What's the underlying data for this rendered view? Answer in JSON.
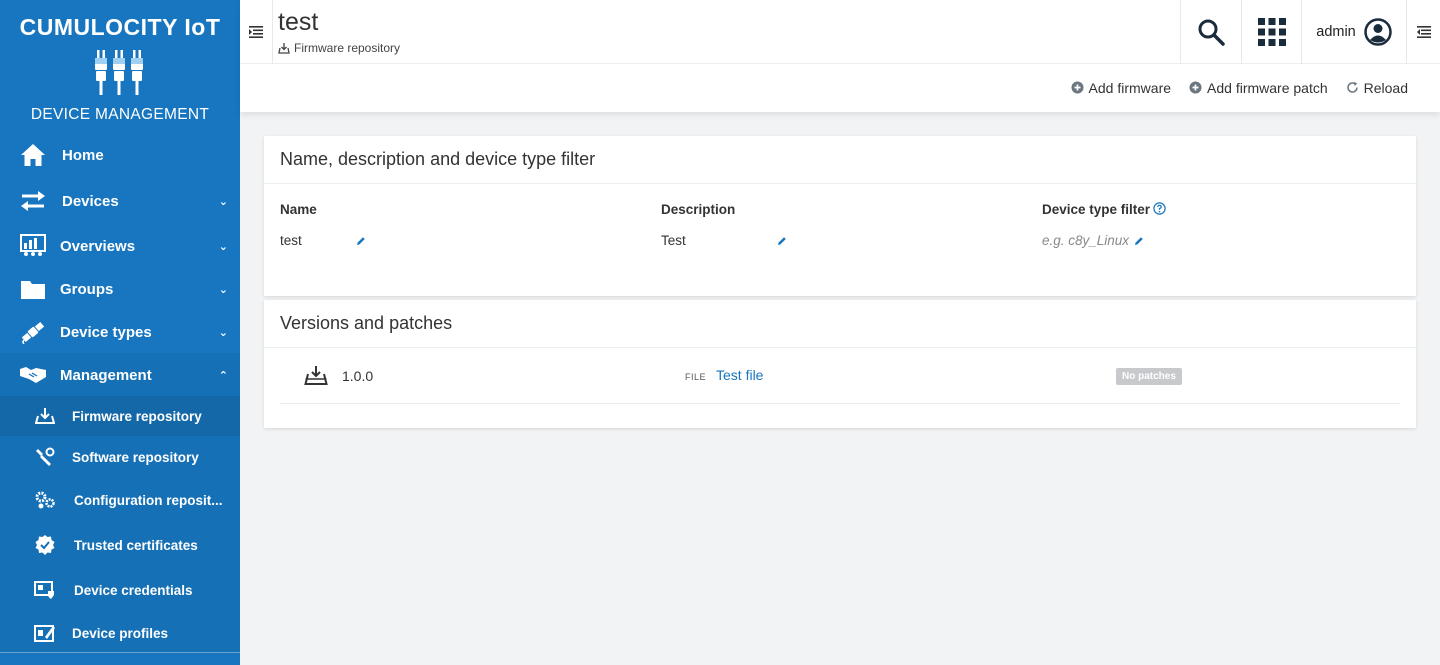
{
  "brand": {
    "title": "CUMULOCITY IoT",
    "subtitle": "DEVICE MANAGEMENT"
  },
  "sidebar": {
    "nav": [
      {
        "label": "Home",
        "icon": "home-icon",
        "chevron": ""
      },
      {
        "label": "Devices",
        "icon": "exchange-arrows-icon",
        "chevron": "⌄"
      },
      {
        "label": "Overviews",
        "icon": "dashboard-icon",
        "chevron": "⌄"
      },
      {
        "label": "Groups",
        "icon": "folder-icon",
        "chevron": "⌄"
      },
      {
        "label": "Device types",
        "icon": "satellite-icon",
        "chevron": "⌄"
      },
      {
        "label": "Management",
        "icon": "handshake-icon",
        "chevron": "⌃"
      }
    ],
    "sub": [
      {
        "label": "Firmware repository",
        "icon": "firmware-icon"
      },
      {
        "label": "Software repository",
        "icon": "software-icon"
      },
      {
        "label": "Configuration reposit...",
        "icon": "configuration-icon"
      },
      {
        "label": "Trusted certificates",
        "icon": "certificate-icon"
      },
      {
        "label": "Device credentials",
        "icon": "credentials-icon"
      },
      {
        "label": "Device profiles",
        "icon": "profile-icon"
      }
    ]
  },
  "header": {
    "title": "test",
    "breadcrumb": "Firmware repository",
    "user": "admin"
  },
  "actions": {
    "add_firmware": "Add firmware",
    "add_patch": "Add firmware patch",
    "reload": "Reload"
  },
  "details": {
    "title": "Name, description and device type filter",
    "name_label": "Name",
    "name_value": "test",
    "description_label": "Description",
    "description_value": "Test",
    "device_type_label": "Device type filter",
    "device_type_placeholder": "e.g. c8y_Linux"
  },
  "versions": {
    "title": "Versions and patches",
    "rows": [
      {
        "version": "1.0.0",
        "file_tag": "FILE",
        "file_name": "Test file",
        "patches": "No patches"
      }
    ]
  },
  "colors": {
    "sidebar": "#1776bf",
    "accent": "#1776bf",
    "background": "#f2f3f4"
  }
}
